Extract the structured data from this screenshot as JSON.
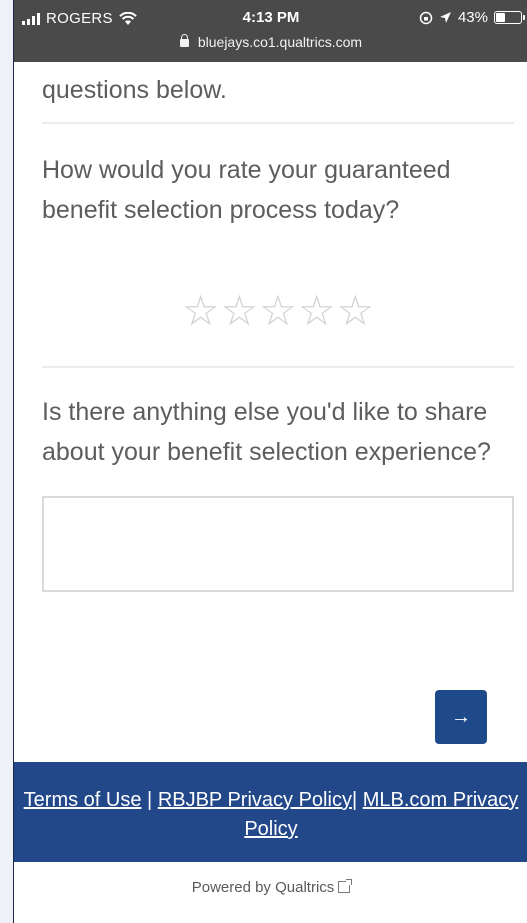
{
  "status_bar": {
    "carrier": "ROGERS",
    "time": "4:13 PM",
    "battery": "43%",
    "battery_level": 0.43,
    "url": "bluejays.co1.qualtrics.com"
  },
  "survey": {
    "intro_fragment": "questions below.",
    "question_1": "How would you rate your guaranteed benefit selection process today?",
    "rating": {
      "max_stars": 5,
      "selected": 0
    },
    "question_2": "Is there anything else you'd like to share about your benefit selection experience?",
    "answer_value": "",
    "next_label": "→"
  },
  "footer": {
    "terms": "Terms of Use",
    "separator": "|",
    "rbjbp_privacy": "RBJBP Privacy Policy",
    "mlb_privacy": "MLB.com Privacy Policy",
    "powered_by": "Powered by Qualtrics"
  },
  "colors": {
    "brand": "#22488a",
    "button": "#1f4a8a",
    "status_bar": "#4a4a4a"
  },
  "icons": [
    "signal-icon",
    "wifi-icon",
    "lock-icon",
    "location-icon",
    "battery-icon",
    "star-icon",
    "external-link-icon"
  ]
}
